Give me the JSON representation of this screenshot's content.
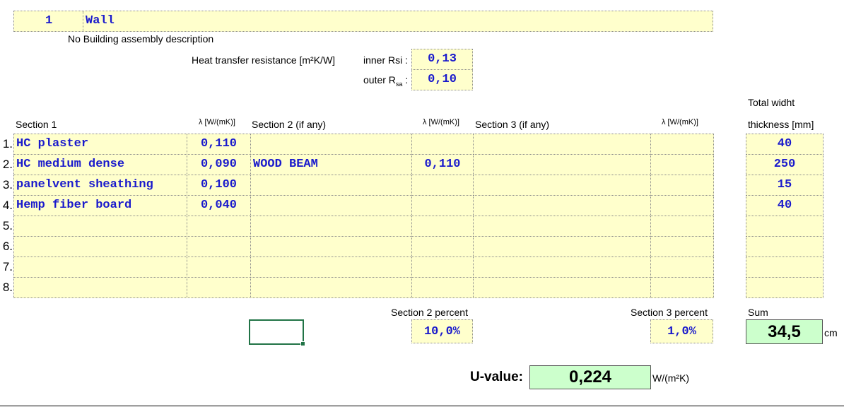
{
  "header": {
    "number": "1",
    "name": "Wall",
    "description": "No Building assembly description"
  },
  "heat_transfer": {
    "label": "Heat transfer resistance [m²K/W]",
    "inner_label": "inner Rsi :",
    "inner_value": "0,13",
    "outer_label_main": "outer R",
    "outer_label_sub": "sa",
    "outer_label_colon": " :",
    "outer_value": "0,10"
  },
  "columns": {
    "section1": "Section 1",
    "section2": "Section 2 (if any)",
    "section3": "Section 3 (if any)",
    "lambda": "λ [W/(mK)]",
    "total_top": "Total widht",
    "total_bottom": "thickness [mm]"
  },
  "rows": [
    {
      "num": "1.",
      "s1": "HC plaster",
      "l1": "0,110",
      "s2": "",
      "l2": "",
      "s3": "",
      "l3": "",
      "t": "40"
    },
    {
      "num": "2.",
      "s1": "HC medium dense",
      "l1": "0,090",
      "s2": "WOOD BEAM",
      "l2": "0,110",
      "s3": "",
      "l3": "",
      "t": "250"
    },
    {
      "num": "3.",
      "s1": "panelvent sheathing",
      "l1": "0,100",
      "s2": "",
      "l2": "",
      "s3": "",
      "l3": "",
      "t": "15"
    },
    {
      "num": "4.",
      "s1": "Hemp fiber board",
      "l1": "0,040",
      "s2": "",
      "l2": "",
      "s3": "",
      "l3": "",
      "t": "40"
    },
    {
      "num": "5.",
      "s1": "",
      "l1": "",
      "s2": "",
      "l2": "",
      "s3": "",
      "l3": "",
      "t": ""
    },
    {
      "num": "6.",
      "s1": "",
      "l1": "",
      "s2": "",
      "l2": "",
      "s3": "",
      "l3": "",
      "t": ""
    },
    {
      "num": "7.",
      "s1": "",
      "l1": "",
      "s2": "",
      "l2": "",
      "s3": "",
      "l3": "",
      "t": ""
    },
    {
      "num": "8.",
      "s1": "",
      "l1": "",
      "s2": "",
      "l2": "",
      "s3": "",
      "l3": "",
      "t": ""
    }
  ],
  "summary": {
    "section2_percent_label": "Section 2 percent",
    "section2_percent": "10,0%",
    "section3_percent_label": "Section 3 percent",
    "section3_percent": "1,0%",
    "sum_label": "Sum",
    "sum_value": "34,5",
    "sum_unit": "cm"
  },
  "result": {
    "label": "U-value:",
    "value": "0,224",
    "unit": "W/(m²K)"
  },
  "colors": {
    "input_cell": "#ffffcc",
    "result_cell": "#ccffcc",
    "input_text": "#1a1acc"
  }
}
